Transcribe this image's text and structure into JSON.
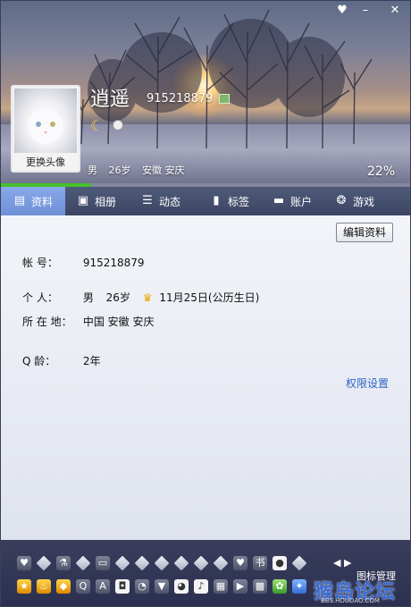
{
  "window": {
    "buttons": {
      "skin": "♥",
      "minimize": "–",
      "close": "✕"
    }
  },
  "header": {
    "nickname": "逍遥",
    "qq_number": "915218879",
    "avatar_caption": "更换头像",
    "gender": "男",
    "age": "26岁",
    "location": "安徽 安庆",
    "completion": "22%",
    "completion_fraction": 0.22,
    "icons": [
      "moon-icon",
      "pet-icon",
      "qq-show-icon"
    ],
    "accent_color": "#44c12a"
  },
  "tabs": [
    {
      "label": "资料",
      "icon": "id-card-icon",
      "active": true
    },
    {
      "label": "相册",
      "icon": "photo-icon",
      "active": false
    },
    {
      "label": "动态",
      "icon": "feed-icon",
      "active": false
    },
    {
      "label": "标签",
      "icon": "bookmark-icon",
      "active": false
    },
    {
      "label": "账户",
      "icon": "wallet-icon",
      "active": false
    },
    {
      "label": "游戏",
      "icon": "game-icon",
      "active": false
    }
  ],
  "main": {
    "edit_button": "编辑资料",
    "account_label": "帐    号：",
    "account_value": "915218879",
    "personal_label": "个    人：",
    "personal_gender": "男",
    "personal_age": "26岁",
    "personal_birthday": "11月25日(公历生日)",
    "location_label": "所 在 地：",
    "location_value": "中国 安徽 安庆",
    "qage_label": "Q      龄：",
    "qage_value": "2年",
    "privacy_link": "权限设置",
    "link_color": "#2d62c6"
  },
  "iconbar": {
    "arrows": "◀ ▶",
    "manage_label": "图标管理",
    "watermark": "猴岛论坛",
    "watermark_url": "BBS.HOUDAO.COM"
  }
}
